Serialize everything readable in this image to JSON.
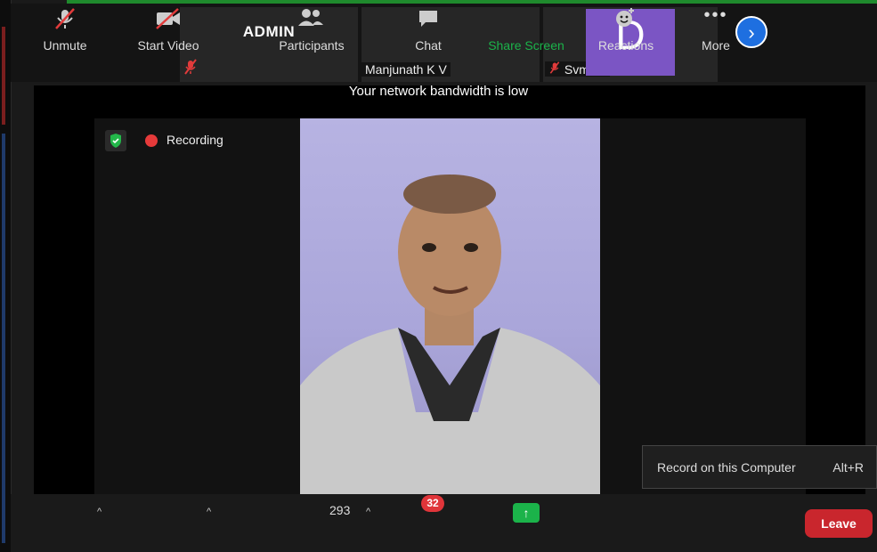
{
  "thumbnails": {
    "admin_title": "ADMIN",
    "participant2_name": "Manjunath K V",
    "participant3_name": "Svm Ait",
    "avatar_letter": "D"
  },
  "banner": {
    "bandwidth_notice": "Your network bandwidth is low"
  },
  "status": {
    "recording_label": "Recording"
  },
  "tooltip": {
    "label": "Record on this Computer",
    "shortcut": "Alt+R"
  },
  "toolbar": {
    "unmute": "Unmute",
    "start_video": "Start Video",
    "participants": "Participants",
    "participants_count": "293",
    "chat": "Chat",
    "chat_badge": "32",
    "share_screen": "Share Screen",
    "reactions": "Reactions",
    "more": "More",
    "leave": "Leave"
  },
  "colors": {
    "accent_green": "#1bb34a",
    "leave_red": "#c9262d",
    "badge_red": "#e0353a",
    "avatar_purple": "#7b55c4",
    "nav_blue": "#1e6fe0"
  }
}
